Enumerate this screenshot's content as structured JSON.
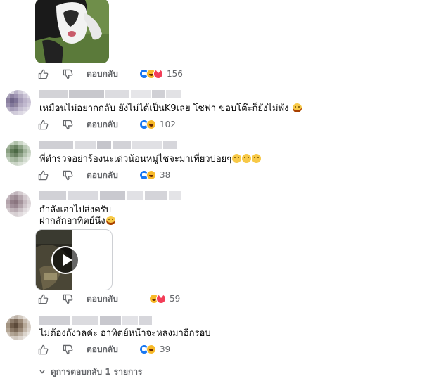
{
  "comments": [
    {
      "text": "",
      "has_photo": true,
      "actions": {
        "reply_label": "ตอบกลับ",
        "reactions": [
          "like",
          "haha",
          "love"
        ],
        "count": "156"
      }
    },
    {
      "text": "เหมือนไม่อยากกลับ ยังไม่ได้เป็นK9เลย โซฟา ขอบโต๊ะก็ยังไม่พัง",
      "emoji": [
        "laugh"
      ],
      "actions": {
        "reply_label": "ตอบกลับ",
        "reactions": [
          "like",
          "haha"
        ],
        "count": "102"
      }
    },
    {
      "text": "พี่ตำรวจอย่าร้องนะเด่วน้อนหมู่ไชจะมาเที่ยวบ่อยๆ",
      "emoji": [
        "grin",
        "grin",
        "grin"
      ],
      "actions": {
        "reply_label": "ตอบกลับ",
        "reactions": [
          "like",
          "haha"
        ],
        "count": "38"
      }
    },
    {
      "text_line1": "กำลังเอาไปส่งครับ",
      "text_line2": "ฝากสักอาทิตย์นึง",
      "emoji": [
        "laugh"
      ],
      "has_video": true,
      "actions": {
        "reply_label": "ตอบกลับ",
        "reactions": [
          "haha",
          "love"
        ],
        "count": "59"
      }
    },
    {
      "text": "ไม่ต้องกังวลค่ะ อาทิตย์หน้าจะหลงมาอีกรอบ",
      "actions": {
        "reply_label": "ตอบกลับ",
        "reactions": [
          "like",
          "haha"
        ],
        "count": "39"
      }
    }
  ],
  "view_replies_label": "ดูการตอบกลับ 1 รายการ",
  "icons": {
    "like": "thumbs-up-icon",
    "dislike": "thumbs-down-icon",
    "expand": "chevron-down-icon"
  },
  "colors": {
    "secondary_text": "#65676b",
    "like_blue": "#1877f2",
    "haha_yellow": "#f7b928",
    "love_red": "#f33e58"
  }
}
